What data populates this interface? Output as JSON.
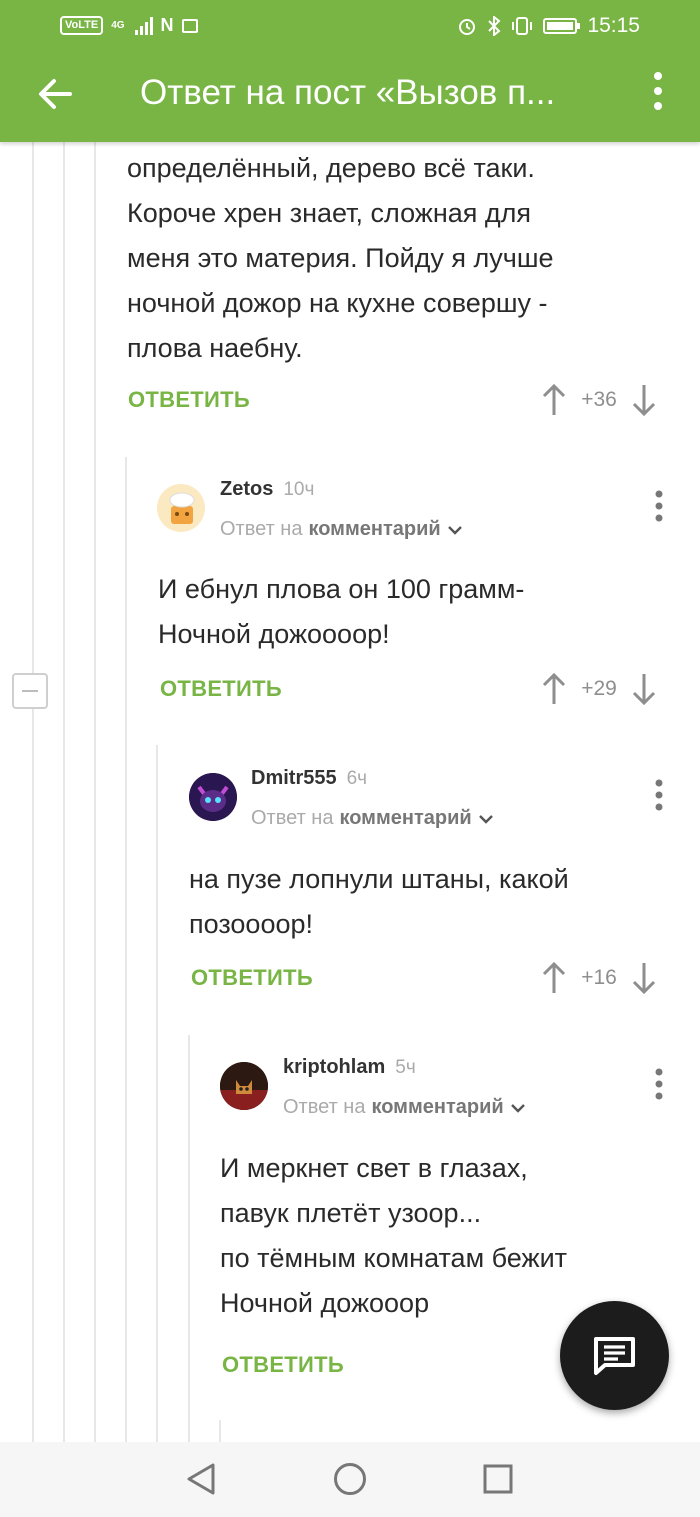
{
  "status_bar": {
    "network_label": "VoLTE",
    "signal_label": "4G",
    "time": "15:15"
  },
  "header": {
    "title": "Ответ на пост «Вызов п...",
    "back_icon": "arrow-left-icon",
    "menu_icon": "more-vertical-icon"
  },
  "colors": {
    "brand": "#79b545",
    "text": "#2a2a2a",
    "muted": "#aaaaaa",
    "fab": "#1c1c1c"
  },
  "comments": [
    {
      "text_lines": [
        "определённый, дерево всё таки.",
        "Короче хрен знает, сложная для",
        "меня это материя. Пойду я лучше",
        "ночной дожор на кухне совершу -",
        "плова наебну."
      ],
      "reply_label": "ОТВЕТИТЬ",
      "score": "+36"
    },
    {
      "author": "Zetos",
      "age": "10ч",
      "reply_prefix": "Ответ на",
      "reply_target": "комментарий",
      "text_lines": [
        "И ебнул плова он 100 грамм-",
        "Ночной дожоооор!"
      ],
      "reply_label": "ОТВЕТИТЬ",
      "score": "+29"
    },
    {
      "author": "Dmitr555",
      "age": "6ч",
      "reply_prefix": "Ответ на",
      "reply_target": "комментарий",
      "text_lines": [
        "на пузе лопнули штаны, какой",
        "позоооор!"
      ],
      "reply_label": "ОТВЕТИТЬ",
      "score": "+16"
    },
    {
      "author": "kriptohlam",
      "age": "5ч",
      "reply_prefix": "Ответ на",
      "reply_target": "комментарий",
      "text_lines": [
        "И меркнет свет в глазах,",
        "павук плетёт узоор...",
        "по тёмным комнатам бежит",
        "Ночной дожооор"
      ],
      "reply_label": "ОТВЕТИТЬ"
    }
  ],
  "fab": {
    "icon": "comment-icon"
  },
  "nav_bar": {
    "back": "nav-back-icon",
    "home": "nav-home-icon",
    "recents": "nav-recents-icon"
  }
}
